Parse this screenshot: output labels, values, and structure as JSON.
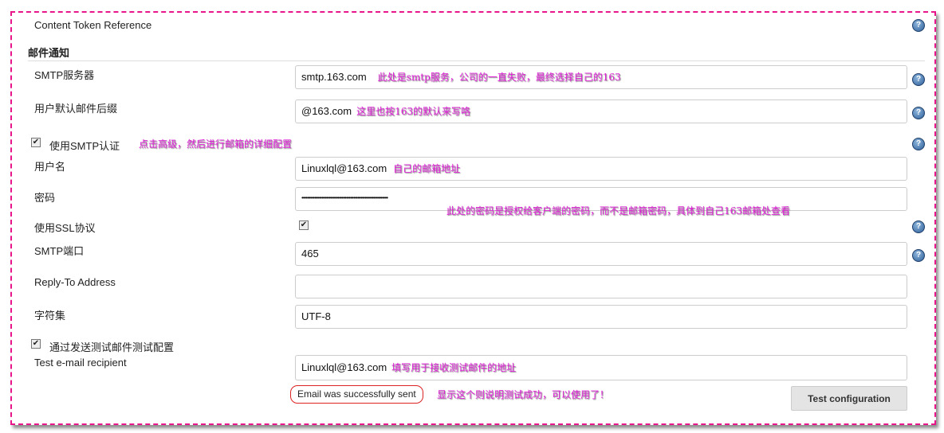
{
  "content_token_reference": "Content Token Reference",
  "section_title": "邮件通知",
  "fields": {
    "smtp_server": {
      "label": "SMTP服务器",
      "value": "smtp.163.com",
      "note": "此处是smtp服务，公司的一直失败，最终选择自己的163"
    },
    "default_suffix": {
      "label": "用户默认邮件后缀",
      "value": "@163.com",
      "note": "这里也按163的默认来写咯"
    },
    "use_smtp_auth": {
      "label": "使用SMTP认证",
      "checked": true,
      "note": "点击高级，然后进行邮箱的详细配置"
    },
    "username": {
      "label": "用户名",
      "value": "Linuxlql@163.com",
      "note": "自己的邮箱地址"
    },
    "password": {
      "label": "密码",
      "value": "••••••••••••••••••••••••••••••••••••••••••••••••••••••••••••",
      "note": "此处的密码是授权给客户端的密码，而不是邮箱密码，具体到自己163邮箱处查看"
    },
    "use_ssl": {
      "label": "使用SSL协议",
      "checked": true
    },
    "smtp_port": {
      "label": "SMTP端口",
      "value": "465"
    },
    "reply_to": {
      "label": "Reply-To Address",
      "value": ""
    },
    "charset": {
      "label": "字符集",
      "value": "UTF-8"
    },
    "test_by_email": {
      "label": "通过发送测试邮件测试配置",
      "checked": true
    },
    "test_recipient": {
      "label": "Test e-mail recipient",
      "value": "Linuxlql@163.com",
      "note": "填写用于接收测试邮件的地址"
    }
  },
  "status": {
    "text": "Email was successfully sent",
    "note": "显示这个则说明测试成功，可以使用了！"
  },
  "test_button": "Test configuration",
  "help_icon": "?",
  "colors": {
    "annotation": "#e020d8",
    "frame": "#e8168a",
    "success_border": "#dd2222"
  }
}
